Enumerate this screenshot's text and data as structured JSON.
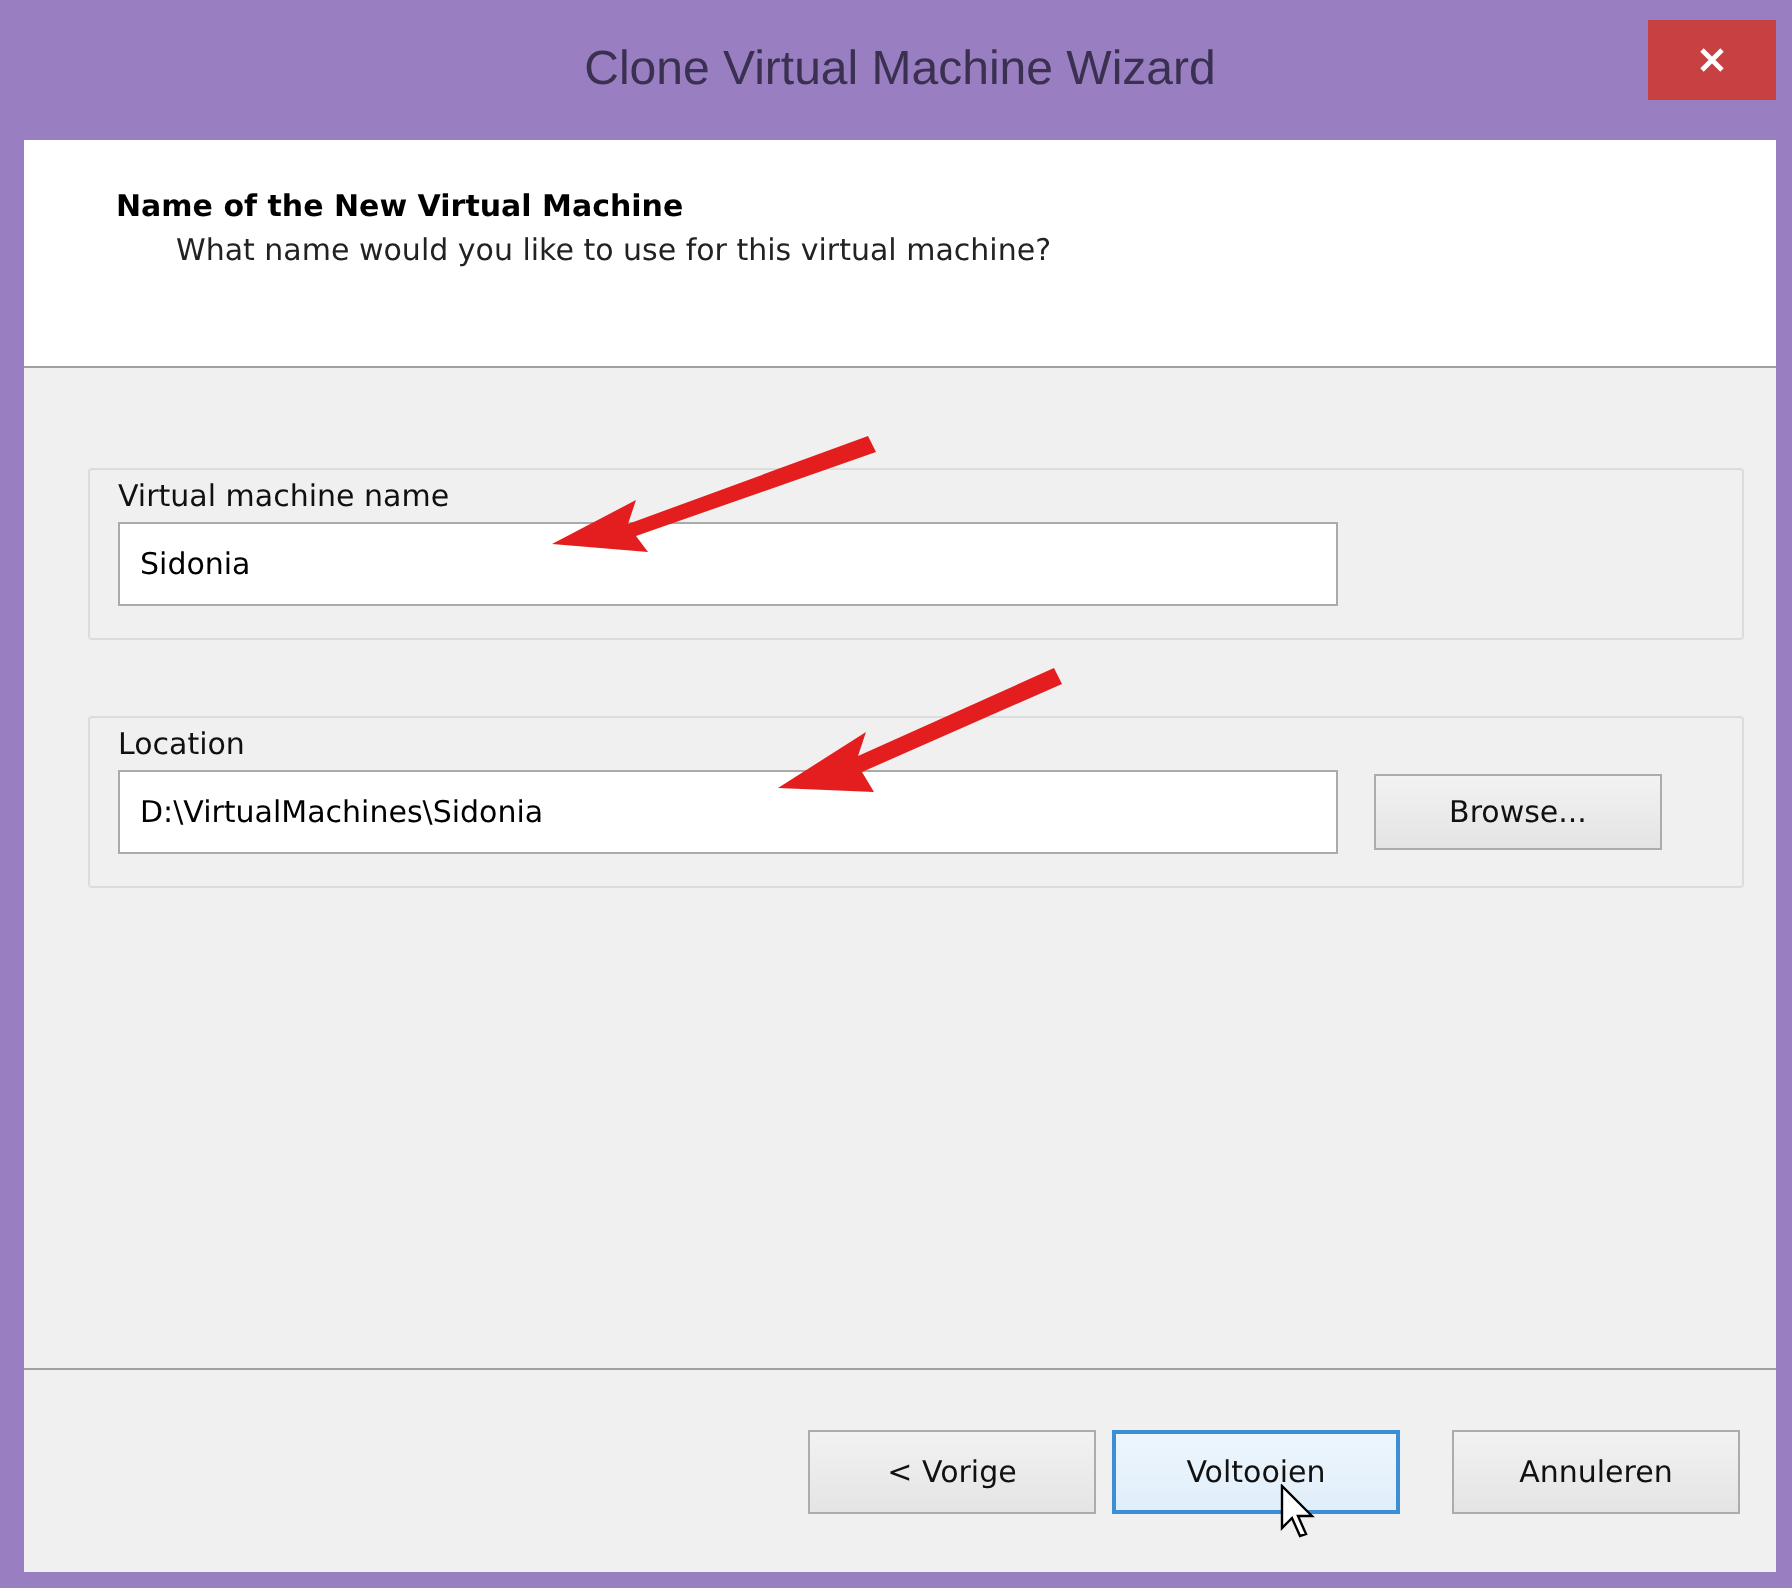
{
  "window": {
    "title": "Clone Virtual Machine Wizard"
  },
  "header": {
    "title": "Name of the New Virtual Machine",
    "subtitle": "What name would you like to use for this virtual machine?"
  },
  "fields": [
    {
      "label": "Virtual machine name",
      "value": "Sidonia"
    },
    {
      "label": "Location",
      "value": "D:\\VirtualMachines\\Sidonia",
      "button": "Browse..."
    }
  ],
  "buttons": [
    {
      "label": "< Vorige",
      "focused": false
    },
    {
      "label": "Voltooien",
      "focused": true
    },
    {
      "label": "Annuleren",
      "focused": false
    }
  ]
}
